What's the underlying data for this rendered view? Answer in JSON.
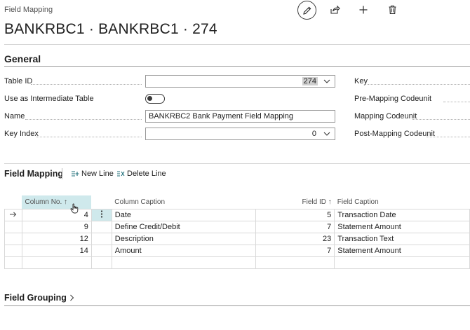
{
  "header": {
    "caption": "Field Mapping",
    "title": "BANKRBC1 · BANKRBC1 · 274"
  },
  "general": {
    "heading": "General",
    "fields": {
      "table_id_label": "Table ID",
      "table_id_value": "274",
      "use_intermediate_label": "Use as Intermediate Table",
      "name_label": "Name",
      "name_value": "BANKRBC2 Bank Payment Field Mapping",
      "key_index_label": "Key Index",
      "key_index_value": "0",
      "key_label": "Key",
      "pre_mapping_label": "Pre-Mapping Codeunit",
      "mapping_label": "Mapping Codeunit",
      "post_mapping_label": "Post-Mapping Codeunit"
    }
  },
  "field_mapping": {
    "heading": "Field Mapping",
    "new_line": "New Line",
    "delete_line": "Delete Line",
    "columns": {
      "column_no": "Column No. ↑",
      "column_caption": "Column Caption",
      "field_id": "Field ID ↑",
      "field_caption": "Field Caption"
    },
    "rows": [
      {
        "column_no": "4",
        "column_caption": "Date",
        "field_id": "5",
        "field_caption": "Transaction Date"
      },
      {
        "column_no": "9",
        "column_caption": "Define Credit/Debit",
        "field_id": "7",
        "field_caption": "Statement Amount"
      },
      {
        "column_no": "12",
        "column_caption": "Description",
        "field_id": "23",
        "field_caption": "Transaction Text"
      },
      {
        "column_no": "14",
        "column_caption": "Amount",
        "field_id": "7",
        "field_caption": "Statement Amount"
      }
    ]
  },
  "field_grouping": {
    "heading": "Field Grouping"
  },
  "colors": {
    "accent_teal": "#cfe9ec",
    "accent_selected": "#cfe9ec"
  }
}
